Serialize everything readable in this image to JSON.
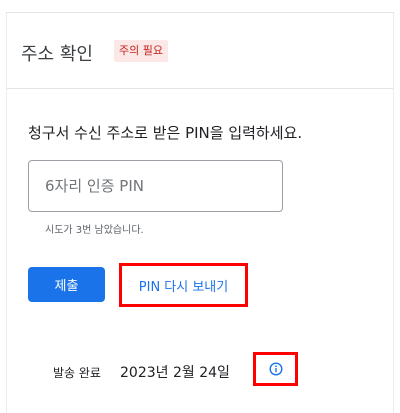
{
  "header": {
    "title": "주소 확인",
    "badge": "주의 필요"
  },
  "form": {
    "instruction": "청구서 수신 주소로 받은 PIN을 입력하세요.",
    "pin_placeholder": "6자리 인증 PIN",
    "pin_value": "",
    "attempts_text": "시도가 3번 남았습니다.",
    "submit_label": "제출",
    "resend_label": "PIN 다시 보내기"
  },
  "status": {
    "sent_label": "발송 완료",
    "sent_date": "2023년 2월 24일",
    "info_icon": "info-icon"
  },
  "colors": {
    "accent": "#1a73e8",
    "badge_text": "#c5221f",
    "badge_bg": "#fce8e6",
    "highlight": "#ff0000"
  }
}
